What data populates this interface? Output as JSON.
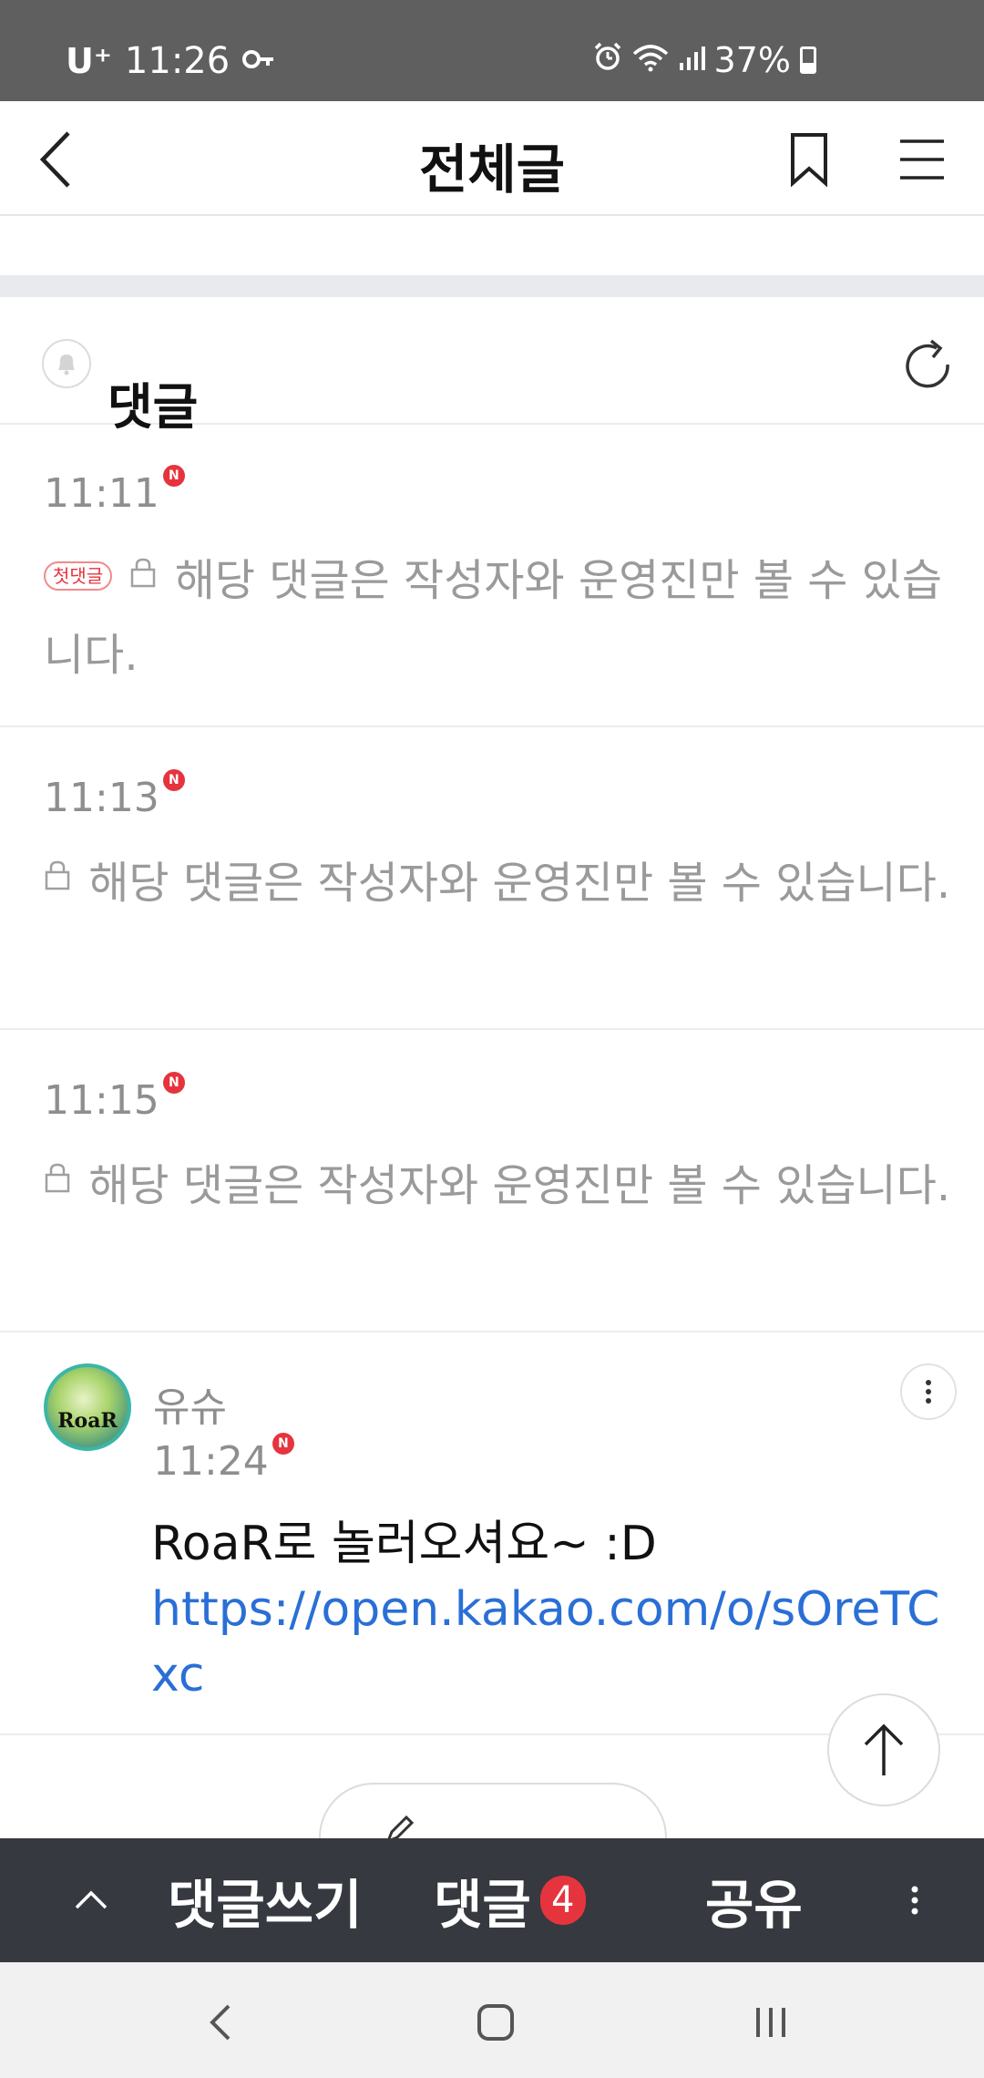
{
  "status_bar": {
    "carrier": "U⁺",
    "time": "11:26",
    "battery": "37%"
  },
  "header": {
    "title": "전체글"
  },
  "comments_section": {
    "title": "댓글"
  },
  "comments": [
    {
      "time": "11:11",
      "new_badge": "N",
      "first_badge": "첫댓글",
      "text": "해당 댓글은 작성자와 운영진만 볼 수 있습니다."
    },
    {
      "time": "11:13",
      "new_badge": "N",
      "text": "해당 댓글은 작성자와 운영진만 볼 수 있습니다."
    },
    {
      "time": "11:15",
      "new_badge": "N",
      "text": "해당 댓글은 작성자와 운영진만 볼 수 있습니다."
    }
  ],
  "author_comment": {
    "avatar_label": "RoaR",
    "name": "유슈",
    "time": "11:24",
    "new_badge": "N",
    "message": "RoaR로 놀러오셔요~ :D",
    "link": "https://open.kakao.com/o/sOreTCxc"
  },
  "action_bar": {
    "write_label": "댓글쓰기",
    "comments_label": "댓글",
    "comments_count": "4",
    "share_label": "공유"
  },
  "icons": {
    "accent_red": "#e6343e",
    "link_blue": "#2a6fd6"
  }
}
